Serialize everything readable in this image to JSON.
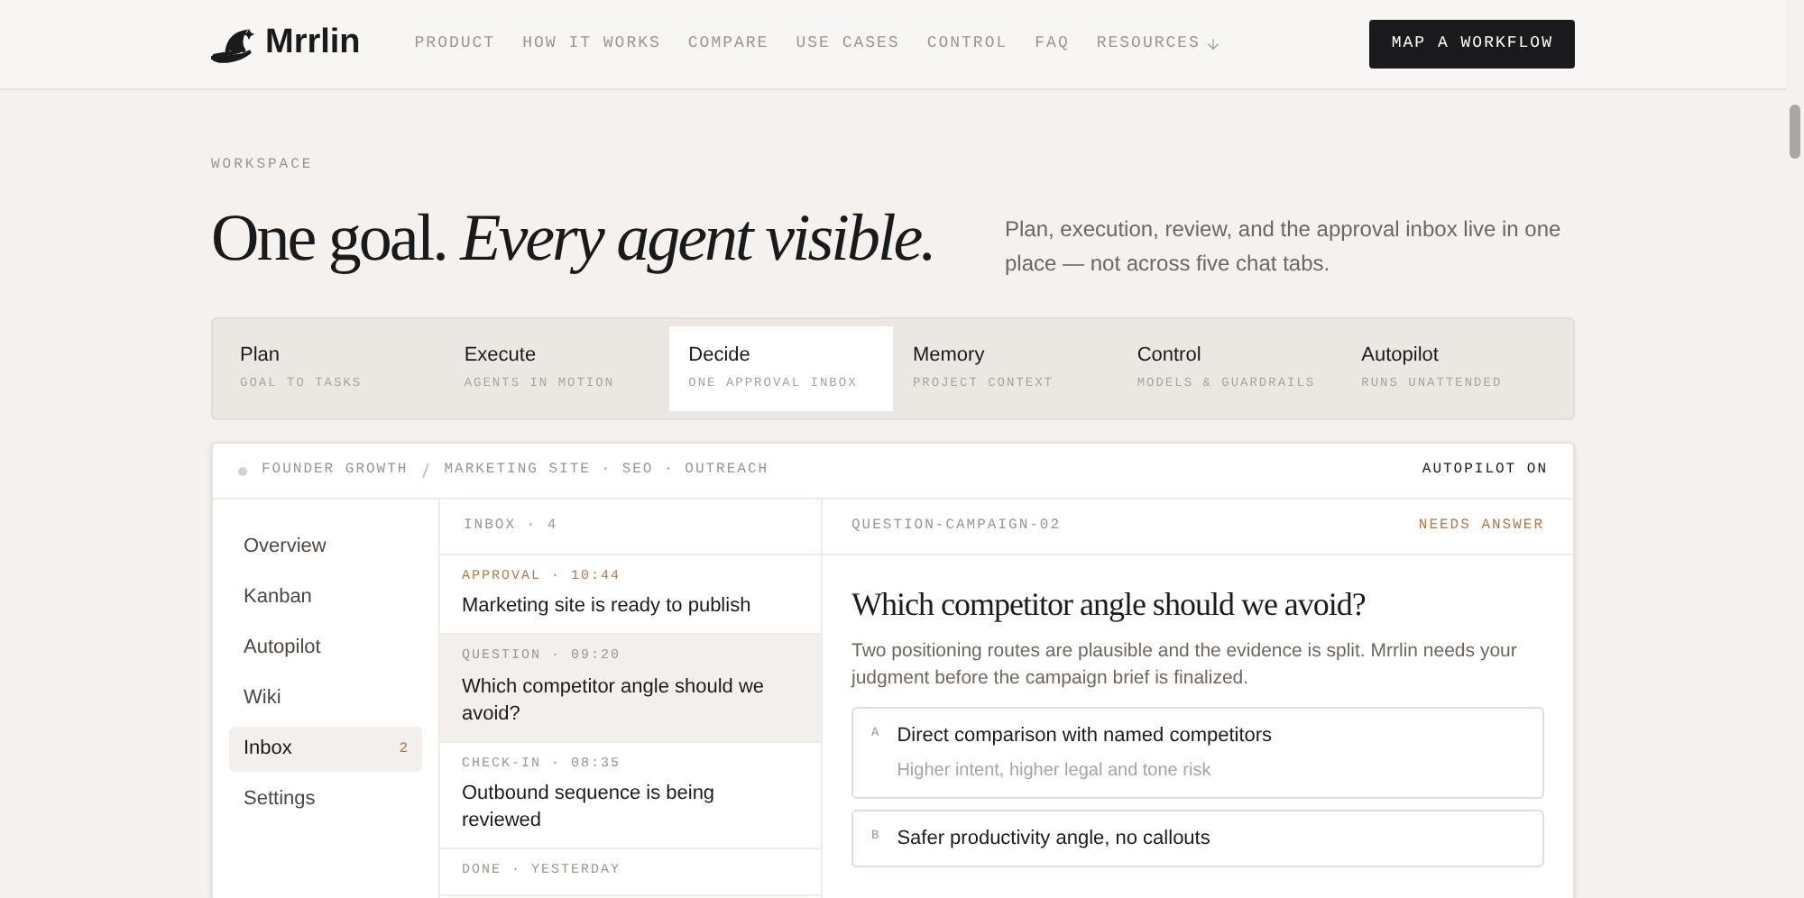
{
  "brand": {
    "name": "Mrrlin"
  },
  "nav": [
    {
      "label": "PRODUCT",
      "dropdown": false
    },
    {
      "label": "HOW IT WORKS",
      "dropdown": false
    },
    {
      "label": "COMPARE",
      "dropdown": false
    },
    {
      "label": "USE CASES",
      "dropdown": false
    },
    {
      "label": "CONTROL",
      "dropdown": false
    },
    {
      "label": "FAQ",
      "dropdown": false
    },
    {
      "label": "RESOURCES",
      "dropdown": true
    }
  ],
  "cta": "MAP A WORKFLOW",
  "eyebrow": "WORKSPACE",
  "headline": {
    "plain": "One goal.",
    "italic": "Every agent visible."
  },
  "intro": "Plan, execution, review, and the approval inbox live in one place — not across five chat tabs.",
  "tabs": [
    {
      "label": "Plan",
      "caption": "GOAL TO TASKS",
      "selected": false
    },
    {
      "label": "Execute",
      "caption": "AGENTS IN MOTION",
      "selected": false
    },
    {
      "label": "Decide",
      "caption": "ONE APPROVAL INBOX",
      "selected": true
    },
    {
      "label": "Memory",
      "caption": "PROJECT CONTEXT",
      "selected": false
    },
    {
      "label": "Control",
      "caption": "MODELS & GUARDRAILS",
      "selected": false
    },
    {
      "label": "Autopilot",
      "caption": "RUNS UNATTENDED",
      "selected": false
    }
  ],
  "workspace": {
    "breadcrumb": [
      "FOUNDER GROWTH",
      "MARKETING SITE · SEO · OUTREACH"
    ],
    "status": "AUTOPILOT ON",
    "sidebar": [
      {
        "label": "Overview",
        "selected": false
      },
      {
        "label": "Kanban",
        "selected": false
      },
      {
        "label": "Autopilot",
        "selected": false
      },
      {
        "label": "Wiki",
        "selected": false
      },
      {
        "label": "Inbox",
        "selected": true,
        "count": "2"
      },
      {
        "label": "Settings",
        "selected": false
      }
    ],
    "inbox": {
      "header": "INBOX · 4",
      "items": [
        {
          "kind": "approval",
          "meta": "APPROVAL · 10:44",
          "title": "Marketing site is ready to publish",
          "selected": false
        },
        {
          "kind": "question",
          "meta": "QUESTION · 09:20",
          "title": "Which competitor angle should we avoid?",
          "selected": true
        },
        {
          "kind": "checkin",
          "meta": "CHECK-IN · 08:35",
          "title": "Outbound sequence is being reviewed",
          "selected": false
        },
        {
          "kind": "done",
          "meta": "DONE · YESTERDAY",
          "selected": false
        }
      ]
    },
    "detail": {
      "id": "QUESTION-CAMPAIGN-02",
      "status": "NEEDS ANSWER",
      "title": "Which competitor angle should we avoid?",
      "body": "Two positioning routes are plausible and the evidence is split. Mrrlin needs your judgment before the campaign brief is finalized.",
      "options": [
        {
          "letter": "A",
          "title": "Direct comparison with named competitors",
          "note": "Higher intent, higher legal and tone risk"
        },
        {
          "letter": "B",
          "title": "Safer productivity angle, no callouts"
        }
      ]
    }
  }
}
